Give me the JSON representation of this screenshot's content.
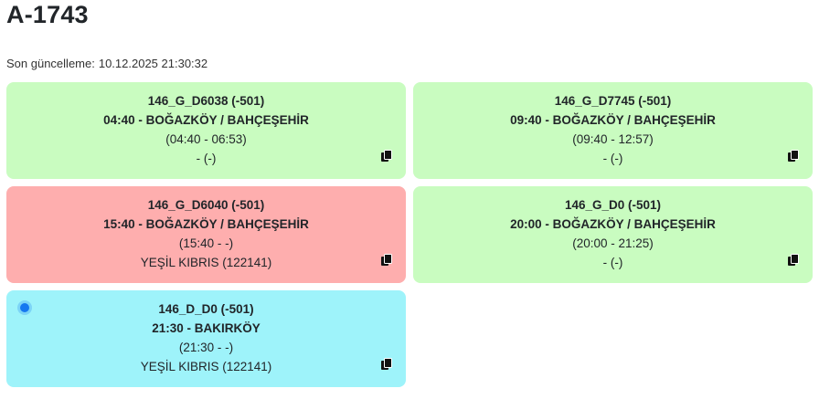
{
  "page": {
    "title": "A-1743",
    "updated_label": "Son güncelleme:",
    "updated_value": "10.12.2025 21:30:32"
  },
  "cards": [
    {
      "code": "146_G_D6038 (-501)",
      "route": "04:40 - BOĞAZKÖY / BAHÇEŞEHİR",
      "times": "(04:40 - 06:53)",
      "vehicle": "- (-)",
      "status_color": "#c9fcc0"
    },
    {
      "code": "146_G_D7745 (-501)",
      "route": "09:40 - BOĞAZKÖY / BAHÇEŞEHİR",
      "times": "(09:40 - 12:57)",
      "vehicle": "- (-)",
      "status_color": "#c9fcc0"
    },
    {
      "code": "146_G_D6040 (-501)",
      "route": "15:40 - BOĞAZKÖY / BAHÇEŞEHİR",
      "times": "(15:40 - -)",
      "vehicle": "YEŞİL KIBRIS (122141)",
      "status_color": "#feaeae"
    },
    {
      "code": "146_G_D0 (-501)",
      "route": "20:00 - BOĞAZKÖY / BAHÇEŞEHİR",
      "times": "(20:00 - 21:25)",
      "vehicle": "- (-)",
      "status_color": "#c9fcc0"
    },
    {
      "code": "146_D_D0 (-501)",
      "route": "21:30 - BAKIRKÖY",
      "times": "(21:30 - -)",
      "vehicle": "YEŞİL KIBRIS (122141)",
      "status_color": "#9ef3fa",
      "active_indicator_color": "#1678f0"
    }
  ],
  "icons": {
    "copy": "copy-icon",
    "active": "active-dot-icon"
  }
}
